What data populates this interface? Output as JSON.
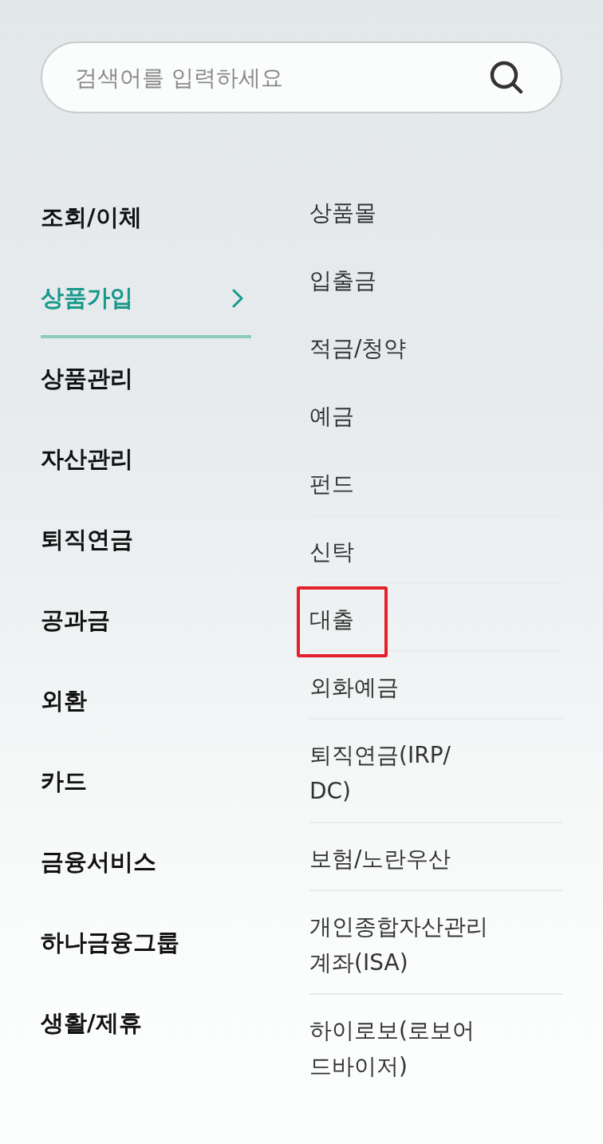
{
  "search": {
    "placeholder": "검색어를 입력하세요"
  },
  "categories": [
    {
      "label": "조회/이체",
      "selected": false
    },
    {
      "label": "상품가입",
      "selected": true
    },
    {
      "label": "상품관리",
      "selected": false
    },
    {
      "label": "자산관리",
      "selected": false
    },
    {
      "label": "퇴직연금",
      "selected": false
    },
    {
      "label": "공과금",
      "selected": false
    },
    {
      "label": "외환",
      "selected": false
    },
    {
      "label": "카드",
      "selected": false
    },
    {
      "label": "금융서비스",
      "selected": false
    },
    {
      "label": "하나금융그룹",
      "selected": false
    },
    {
      "label": "생활/제휴",
      "selected": false
    }
  ],
  "subcategories": [
    {
      "label": "상품몰",
      "highlighted": false
    },
    {
      "label": "입출금",
      "highlighted": false
    },
    {
      "label": "적금/청약",
      "highlighted": false
    },
    {
      "label": "예금",
      "highlighted": false
    },
    {
      "label": "펀드",
      "highlighted": false
    },
    {
      "label": "신탁",
      "highlighted": false
    },
    {
      "label": "대출",
      "highlighted": true
    },
    {
      "label": "외화예금",
      "highlighted": false
    },
    {
      "label": "퇴직연금(IRP/\nDC)",
      "highlighted": false
    },
    {
      "label": "보험/노란우산",
      "highlighted": false
    },
    {
      "label": "개인종합자산관리\n계좌(ISA)",
      "highlighted": false
    },
    {
      "label": "하이로보(로보어\n드바이저)",
      "highlighted": false
    }
  ]
}
